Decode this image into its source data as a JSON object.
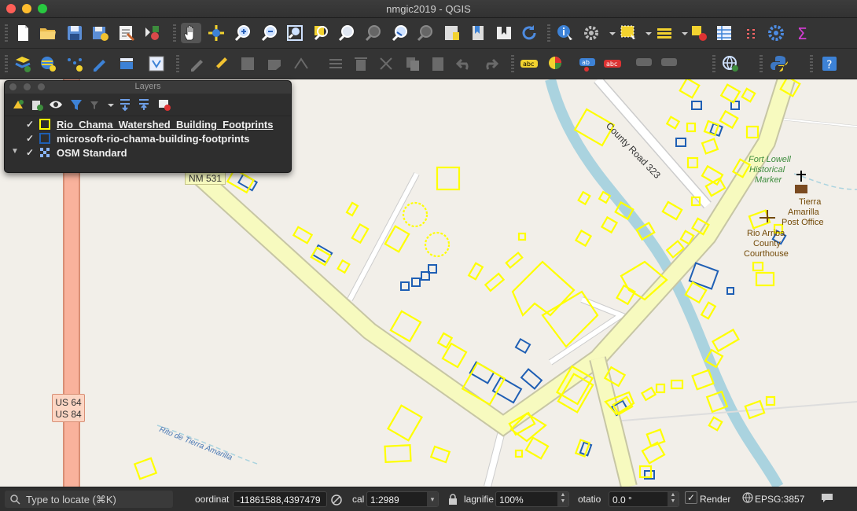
{
  "window": {
    "title": "nmgic2019 - QGIS"
  },
  "toolbars": {
    "row1": [
      "new-project",
      "open-project",
      "save-project",
      "save-as",
      "print-layout",
      "style-manager",
      "pan",
      "pan-to-selection",
      "zoom-in",
      "zoom-out",
      "zoom-full",
      "zoom-to-selection",
      "zoom-to-layer",
      "zoom-native",
      "zoom-last",
      "zoom-next",
      "new-bookmark",
      "show-bookmarks",
      "spatial-bookmark",
      "refresh",
      "identify",
      "settings-gear",
      "select",
      "deselect",
      "select-by-value",
      "attribute-table",
      "field-calculator",
      "toolbox",
      "statistics"
    ],
    "row2": [
      "data-source-manager",
      "new-geopackage",
      "new-temp-layer",
      "digitize",
      "current-edits",
      "toggle-editing",
      "save-edits",
      "add-feature",
      "vertex-tool",
      "delete",
      "cut",
      "copy",
      "paste",
      "undo",
      "redo",
      "label-tool",
      "pin-labels",
      "highlight-labels",
      "move-label",
      "rotate-label",
      "change-label",
      "python-console",
      "help"
    ]
  },
  "layers_panel": {
    "title": "Layers",
    "layers": [
      {
        "name": "Rio_Chama_Watershed_Building_Footprints",
        "checked": "✓",
        "color": "#ffff00"
      },
      {
        "name": "microsoft-rio-chama-building-footprints",
        "checked": "✓",
        "color": "#1f5fb4"
      },
      {
        "name": "OSM Standard",
        "checked": "✓",
        "color": "#4a78b5"
      }
    ]
  },
  "map": {
    "labels": {
      "nm531": "NM 531",
      "county_road": "County Road 323",
      "fort_lowell_1": "Fort Lowell",
      "fort_lowell_2": "Historical",
      "fort_lowell_3": "Marker",
      "post_office_1": "Tierra",
      "post_office_2": "Amarilla",
      "post_office_3": "Post Office",
      "courthouse_1": "Rio Arriba",
      "courthouse_2": "County",
      "courthouse_3": "Courthouse",
      "us64": "US 64",
      "us84": "US 84",
      "rito": "Rito de Tierra Amarilla"
    },
    "colors": {
      "background": "#f2efe9",
      "road_primary": "#f7fabf",
      "road_trunk": "#f9b29c",
      "water": "#aad3df",
      "footprint_a": "#ffff00",
      "footprint_b": "#1f5fb4"
    }
  },
  "statusbar": {
    "locate_placeholder": "Type to locate (⌘K)",
    "coordinate_label": "oordinat",
    "coordinate_value": "-11861588,4397479",
    "scale_label": "cal",
    "scale_value": "1:2989",
    "magnifier_label": "lagnifie",
    "magnifier_value": "100%",
    "rotation_label": "otatio",
    "rotation_value": "0.0 °",
    "render_label": "Render",
    "render_checked": "✓",
    "crs": "EPSG:3857"
  }
}
